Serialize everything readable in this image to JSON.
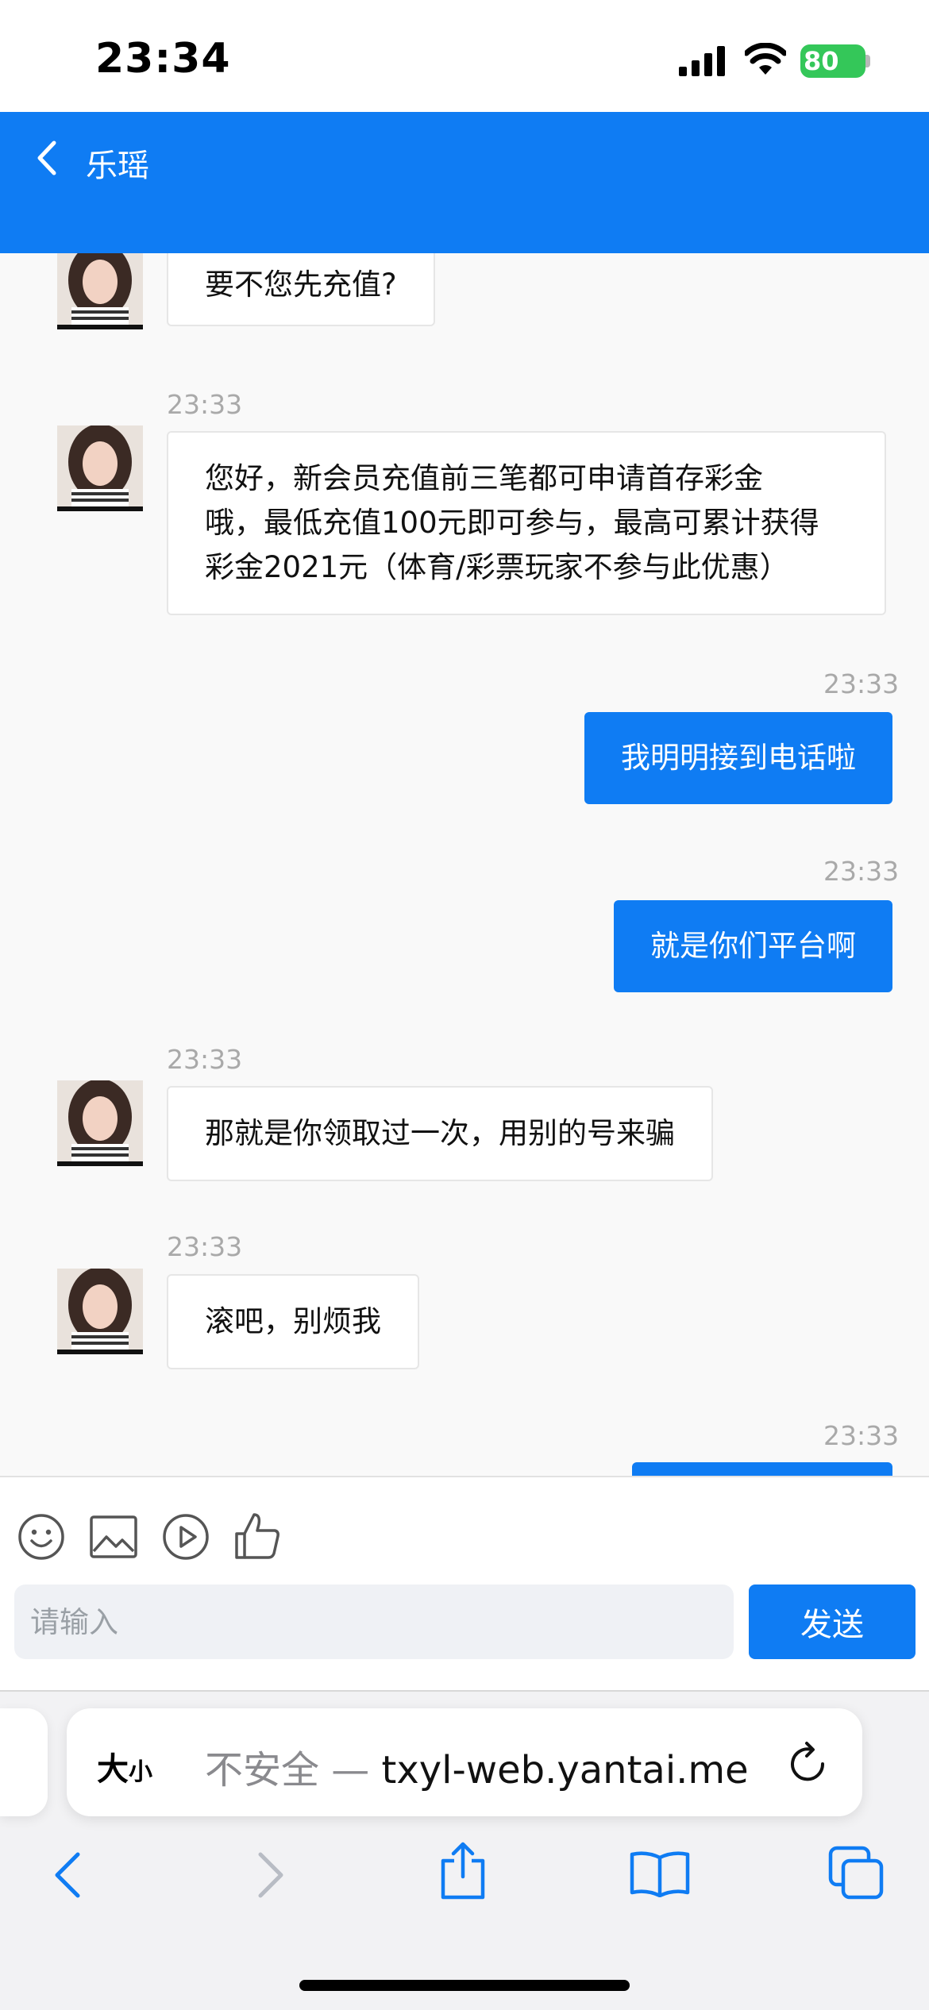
{
  "status_bar": {
    "time": "23:34",
    "battery": "80"
  },
  "header": {
    "title": "乐瑶"
  },
  "messages": [
    {
      "time": "",
      "text": "要不您先充值?"
    },
    {
      "time": "23:33",
      "lines": [
        "您好，新会员充值前三笔都可申请首存彩金",
        "哦，最低充值100元即可参与，最高可累计获得",
        "彩金2021元（体育/彩票玩家不参与此优惠）"
      ]
    },
    {
      "time": "23:33",
      "text": "我明明接到电话啦"
    },
    {
      "time": "23:33",
      "text": "就是你们平台啊"
    },
    {
      "time": "23:33",
      "text": "那就是你领取过一次，用别的号来骗"
    },
    {
      "time": "23:33",
      "text": "滚吧，别烦我"
    },
    {
      "time": "23:33",
      "text": ""
    }
  ],
  "input": {
    "placeholder": "请输入",
    "send_label": "发送"
  },
  "toolbar_icons": [
    "emoji-icon",
    "image-icon",
    "video-icon",
    "thumbs-up-icon"
  ],
  "browser": {
    "text_size_big": "大",
    "text_size_small": "小",
    "url_prefix": "不安全 — ",
    "url_domain": "txyl-web.yantai.me"
  },
  "colors": {
    "accent": "#0f7cf3",
    "battery": "#34c759"
  }
}
